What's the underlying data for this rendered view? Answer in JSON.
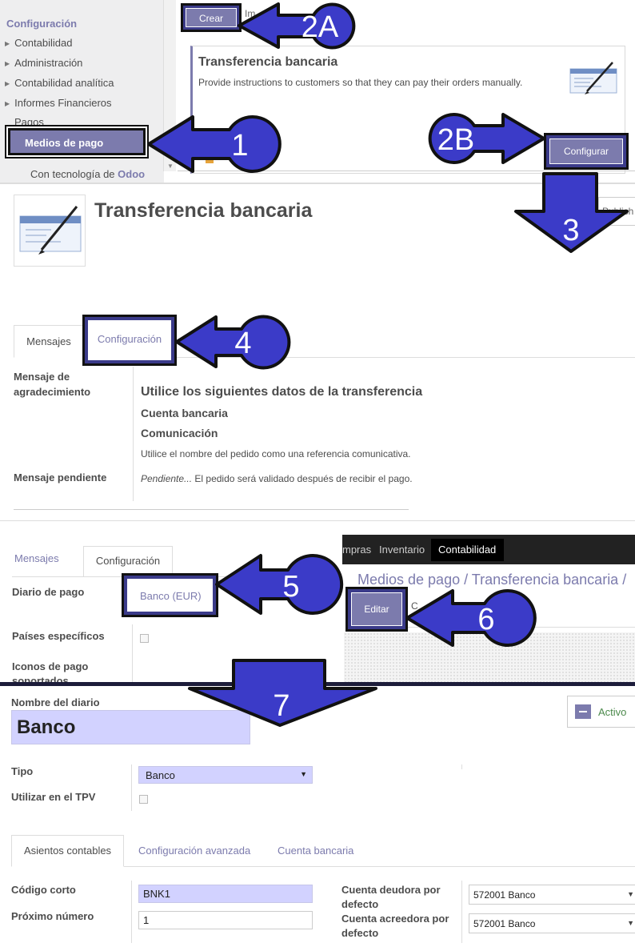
{
  "panel1": {
    "sidebar": {
      "title": "Configuración",
      "items": [
        "Contabilidad",
        "Administración",
        "Contabilidad analítica",
        "Informes Financieros",
        "Pagos"
      ],
      "active_item": "Medios de pago",
      "powered_prefix": "Con tecnología de",
      "powered_brand": "Odoo"
    },
    "crear_button": "Crear",
    "im_text": "Im",
    "card": {
      "title": "Transferencia bancaria",
      "description": "Provide instructions to customers so that they can pay their orders manually.",
      "configure_button": "Configurar"
    }
  },
  "panel2": {
    "title": "Transferencia bancaria",
    "publish_label": "Publish",
    "tabs": [
      "Mensajes",
      "Configuración"
    ],
    "fields": {
      "thanks_label": "Mensaje de agradecimiento",
      "thanks_heading": "Utilice los siguientes datos de la transferencia",
      "thanks_line1": "Cuenta bancaria",
      "thanks_line2": "Comunicación",
      "thanks_note": "Utilice el nombre del pedido como una referencia comunicativa.",
      "pending_label": "Mensaje pendiente",
      "pending_italic": "Pendiente...",
      "pending_text": " El pedido será validado después de recibir el pago."
    }
  },
  "panel3": {
    "tabs": [
      "Mensajes",
      "Configuración"
    ],
    "journal_label": "Diario de pago",
    "journal_value": "Banco (EUR)",
    "countries_label": "Países específicos",
    "icons_label": "Iconos de pago soportados",
    "navbar": {
      "items": [
        "mpras",
        "Inventario"
      ],
      "active": "Contabilidad"
    },
    "breadcrumb": "Medios de pago /  Transferencia bancaria /",
    "edit_button": "Editar",
    "c_letter": "C"
  },
  "panel4": {
    "name_label": "Nombre del diario",
    "name_value": "Banco",
    "active_label": "Activo",
    "type_label": "Tipo",
    "type_value": "Banco",
    "tpv_label": "Utilizar en el TPV",
    "tabs": [
      "Asientos contables",
      "Configuración avanzada",
      "Cuenta bancaria"
    ],
    "short_code_label": "Código corto",
    "short_code_value": "BNK1",
    "next_number_label": "Próximo número",
    "next_number_value": "1",
    "debit_label": "Cuenta deudora por defecto",
    "debit_value": "572001 Banco",
    "credit_label": "Cuenta acreedora por defecto",
    "credit_value": "572001 Banco"
  },
  "callouts": [
    "1",
    "2A",
    "2B",
    "3",
    "4",
    "5",
    "6",
    "7"
  ],
  "colors": {
    "accent": "#7c7bad",
    "callout_fill": "#3b3bc8",
    "callout_border": "#111111",
    "highlight_input": "#d2d2ff"
  }
}
